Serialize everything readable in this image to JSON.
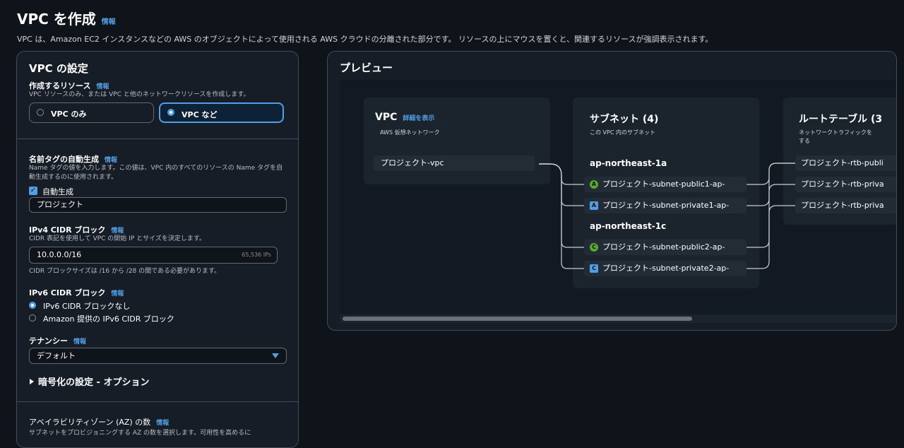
{
  "header": {
    "title": "VPC を作成",
    "info": "情報",
    "description": "VPC は、Amazon EC2 インスタンスなどの AWS のオブジェクトによって使用される AWS クラウドの分離された部分です。 リソースの上にマウスを置くと、関連するリソースが強調表示されます。"
  },
  "settings": {
    "title": "VPC の設定",
    "resources": {
      "label": "作成するリソース",
      "info": "情報",
      "hint": "VPC リソースのみ、または VPC と他のネットワークリソースを作成します。",
      "option_vpc_only": "VPC のみ",
      "option_vpc_more": "VPC など",
      "selected": "VPC など"
    },
    "name_tag": {
      "label": "名前タグの自動生成",
      "info": "情報",
      "hint": "Name タグの値を入力します。この値は、VPC 内のすべてのリソースの Name タグを自動生成するのに使用されます。",
      "checkbox_label": "自動生成",
      "checked": true,
      "value": "プロジェクト"
    },
    "ipv4": {
      "label": "IPv4 CIDR ブロック",
      "info": "情報",
      "hint": "CIDR 表記を使用して VPC の開始 IP とサイズを決定します。",
      "value": "10.0.0.0/16",
      "suffix": "65,536 IPs",
      "constraint": "CIDR ブロックサイズは /16 から /28 の間である必要があります。"
    },
    "ipv6": {
      "label": "IPv6 CIDR ブロック",
      "info": "情報",
      "option_none": "IPv6 CIDR ブロックなし",
      "option_amazon": "Amazon 提供の IPv6 CIDR ブロック",
      "selected": "IPv6 CIDR ブロックなし"
    },
    "tenancy": {
      "label": "テナンシー",
      "info": "情報",
      "value": "デフォルト"
    },
    "encryption": {
      "label": "暗号化の設定 - オプション"
    },
    "az": {
      "label": "アベイラビリティゾーン (AZ) の数",
      "info": "情報",
      "hint": "サブネットをプロビジョニングする AZ の数を選択します。可用性を高めるに"
    }
  },
  "preview": {
    "title": "プレビュー",
    "vpc": {
      "title": "VPC",
      "link": "詳細を表示",
      "subtitle": "AWS 仮想ネットワーク",
      "node": "プロジェクト-vpc"
    },
    "subnets": {
      "title": "サブネット (4)",
      "subtitle": "この VPC 内のサブネット",
      "zones": [
        {
          "name": "ap-northeast-1a",
          "items": [
            {
              "badge": "A",
              "kind": "public",
              "label": "プロジェクト-subnet-public1-ap-"
            },
            {
              "badge": "A",
              "kind": "private",
              "label": "プロジェクト-subnet-private1-ap-"
            }
          ]
        },
        {
          "name": "ap-northeast-1c",
          "items": [
            {
              "badge": "C",
              "kind": "public",
              "label": "プロジェクト-subnet-public2-ap-"
            },
            {
              "badge": "C",
              "kind": "private",
              "label": "プロジェクト-subnet-private2-ap-"
            }
          ]
        }
      ]
    },
    "route_tables": {
      "title": "ルートテーブル (3",
      "subtitle": "ネットワークトラフィックを\nする",
      "items": [
        "プロジェクト-rtb-publi",
        "プロジェクト-rtb-priva",
        "プロジェクト-rtb-priva"
      ]
    }
  }
}
